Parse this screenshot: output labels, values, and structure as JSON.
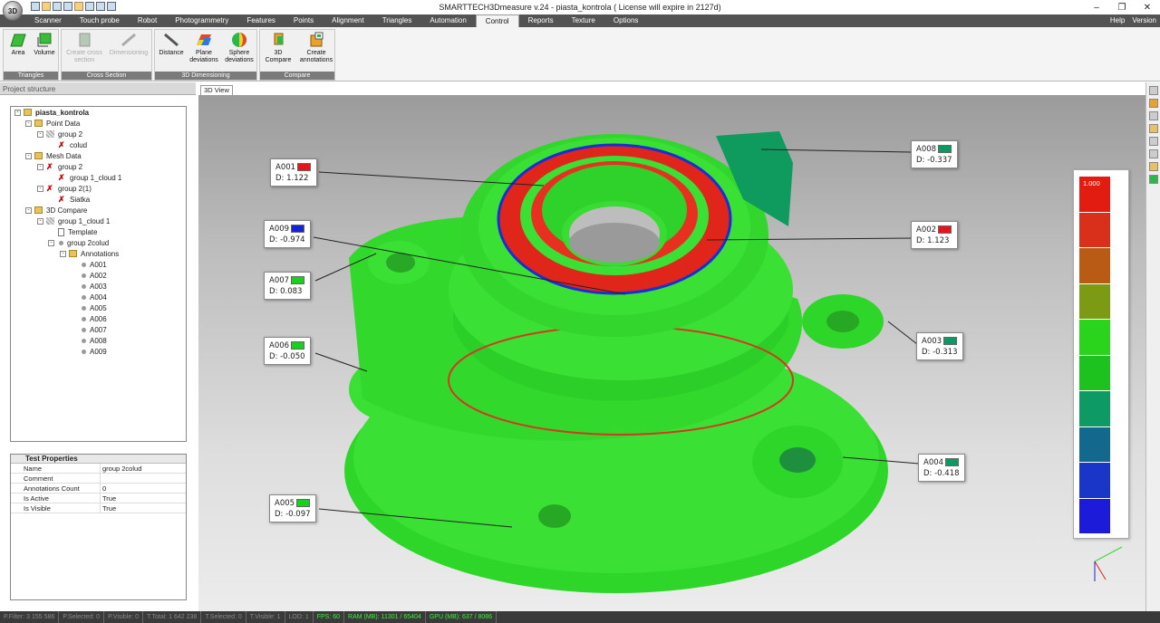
{
  "window": {
    "title": "SMARTTECH3Dmeasure v.24 - piasta_kontrola ( License will expire in 2127d)",
    "logo_text": "3D",
    "buttons": [
      "minimize-icon",
      "restore-icon",
      "close-icon"
    ]
  },
  "menu": {
    "tabs": [
      "Scanner",
      "Touch probe",
      "Robot",
      "Photogrammetry",
      "Features",
      "Points",
      "Alignment",
      "Triangles",
      "Automation",
      "Control",
      "Reports",
      "Texture",
      "Options"
    ],
    "active": "Control",
    "right": [
      "Help",
      "Version"
    ]
  },
  "ribbon": {
    "groups": [
      {
        "label": "Triangles",
        "buttons": [
          {
            "label": "Area",
            "enabled": true,
            "icon": "area-icon"
          },
          {
            "label": "Volume",
            "enabled": true,
            "icon": "volume-icon"
          }
        ]
      },
      {
        "label": "Cross Section",
        "buttons": [
          {
            "label": "Create cross section",
            "enabled": false,
            "icon": "cross-section-icon"
          },
          {
            "label": "Dimensioning",
            "enabled": false,
            "icon": "dimensioning-icon"
          }
        ]
      },
      {
        "label": "3D Dimensioning",
        "buttons": [
          {
            "label": "Distance",
            "enabled": true,
            "icon": "distance-icon"
          },
          {
            "label": "Plane deviations",
            "enabled": true,
            "icon": "plane-deviations-icon"
          },
          {
            "label": "Sphere deviations",
            "enabled": true,
            "icon": "sphere-deviations-icon"
          }
        ]
      },
      {
        "label": "Compare",
        "buttons": [
          {
            "label": "3D Compare",
            "enabled": true,
            "icon": "compare-icon"
          },
          {
            "label": "Create annotations",
            "enabled": true,
            "icon": "annotations-icon"
          }
        ]
      }
    ]
  },
  "project_panel": {
    "title": "Project structure",
    "tree": [
      {
        "label": "piasta_kontrola",
        "level": 0,
        "icon": "folder-icon",
        "bold": true
      },
      {
        "label": "Point Data",
        "level": 1,
        "icon": "folder-icon"
      },
      {
        "label": "group 2",
        "level": 2,
        "icon": "group-icon"
      },
      {
        "label": "colud",
        "level": 3,
        "icon": "hidden-cloud-icon"
      },
      {
        "label": "Mesh Data",
        "level": 1,
        "icon": "folder-icon"
      },
      {
        "label": "group 2",
        "level": 2,
        "icon": "hidden-group-icon"
      },
      {
        "label": "group 1_cloud 1",
        "level": 3,
        "icon": "hidden-mesh-icon"
      },
      {
        "label": "group 2(1)",
        "level": 2,
        "icon": "hidden-group-icon"
      },
      {
        "label": "Siatka",
        "level": 3,
        "icon": "hidden-mesh-icon"
      },
      {
        "label": "3D Compare",
        "level": 1,
        "icon": "folder-icon"
      },
      {
        "label": "group 1_cloud 1",
        "level": 2,
        "icon": "group-icon"
      },
      {
        "label": "Template",
        "level": 3,
        "icon": "document-icon"
      },
      {
        "label": "group 2colud",
        "level": 3,
        "icon": "dot-icon"
      },
      {
        "label": "Annotations",
        "level": 4,
        "icon": "folder-icon"
      },
      {
        "label": "A001",
        "level": 5,
        "icon": "dot-icon"
      },
      {
        "label": "A002",
        "level": 5,
        "icon": "dot-icon"
      },
      {
        "label": "A003",
        "level": 5,
        "icon": "dot-icon"
      },
      {
        "label": "A004",
        "level": 5,
        "icon": "dot-icon"
      },
      {
        "label": "A005",
        "level": 5,
        "icon": "dot-icon"
      },
      {
        "label": "A006",
        "level": 5,
        "icon": "dot-icon"
      },
      {
        "label": "A007",
        "level": 5,
        "icon": "dot-icon"
      },
      {
        "label": "A008",
        "level": 5,
        "icon": "dot-icon"
      },
      {
        "label": "A009",
        "level": 5,
        "icon": "dot-icon"
      }
    ]
  },
  "properties": {
    "title": "Test Properties",
    "rows": [
      {
        "key": "Name",
        "value": "group 2colud"
      },
      {
        "key": "Comment",
        "value": ""
      },
      {
        "key": "Annotations Count",
        "value": "0"
      },
      {
        "key": "Is Active",
        "value": "True"
      },
      {
        "key": "Is Visible",
        "value": "True"
      }
    ]
  },
  "view": {
    "tab": "3D View",
    "annotations": [
      {
        "id": "A001",
        "value": "D: 1.122",
        "color": "#e8141a"
      },
      {
        "id": "A002",
        "value": "D: 1.123",
        "color": "#e8141a"
      },
      {
        "id": "A003",
        "value": "D: -0.313",
        "color": "#0a9a63"
      },
      {
        "id": "A004",
        "value": "D: -0.418",
        "color": "#0a9a63"
      },
      {
        "id": "A005",
        "value": "D: -0.097",
        "color": "#16d21c"
      },
      {
        "id": "A006",
        "value": "D: -0.050",
        "color": "#16d21c"
      },
      {
        "id": "A007",
        "value": "D: 0.083",
        "color": "#16d21c"
      },
      {
        "id": "A008",
        "value": "D: -0.337",
        "color": "#0a9a63"
      },
      {
        "id": "A009",
        "value": "D: -0.974",
        "color": "#1523d8"
      }
    ],
    "legend": {
      "top_label": "1.000",
      "colors": [
        "#e21c10",
        "#d8301a",
        "#b95a15",
        "#7c9a14",
        "#2bd41c",
        "#1ec21e",
        "#0e9a64",
        "#12688d",
        "#1a36c8",
        "#1b1bd9"
      ]
    }
  },
  "statusbar": [
    {
      "text": "P.Filter: 3 155 586",
      "highlight": false
    },
    {
      "text": "P.Selected: 0",
      "highlight": false
    },
    {
      "text": "P.Visible: 0",
      "highlight": false
    },
    {
      "text": "T.Total: 1 642 238",
      "highlight": false
    },
    {
      "text": "T.Selected: 0",
      "highlight": false
    },
    {
      "text": "T.Visible: 1",
      "highlight": false
    },
    {
      "text": "LOD: 1",
      "highlight": false
    },
    {
      "text": "FPS: 60",
      "highlight": true
    },
    {
      "text": "RAM (MB): 11301 / 65404",
      "highlight": true
    },
    {
      "text": "GPU (MB): 637 / 8086",
      "highlight": true
    }
  ]
}
